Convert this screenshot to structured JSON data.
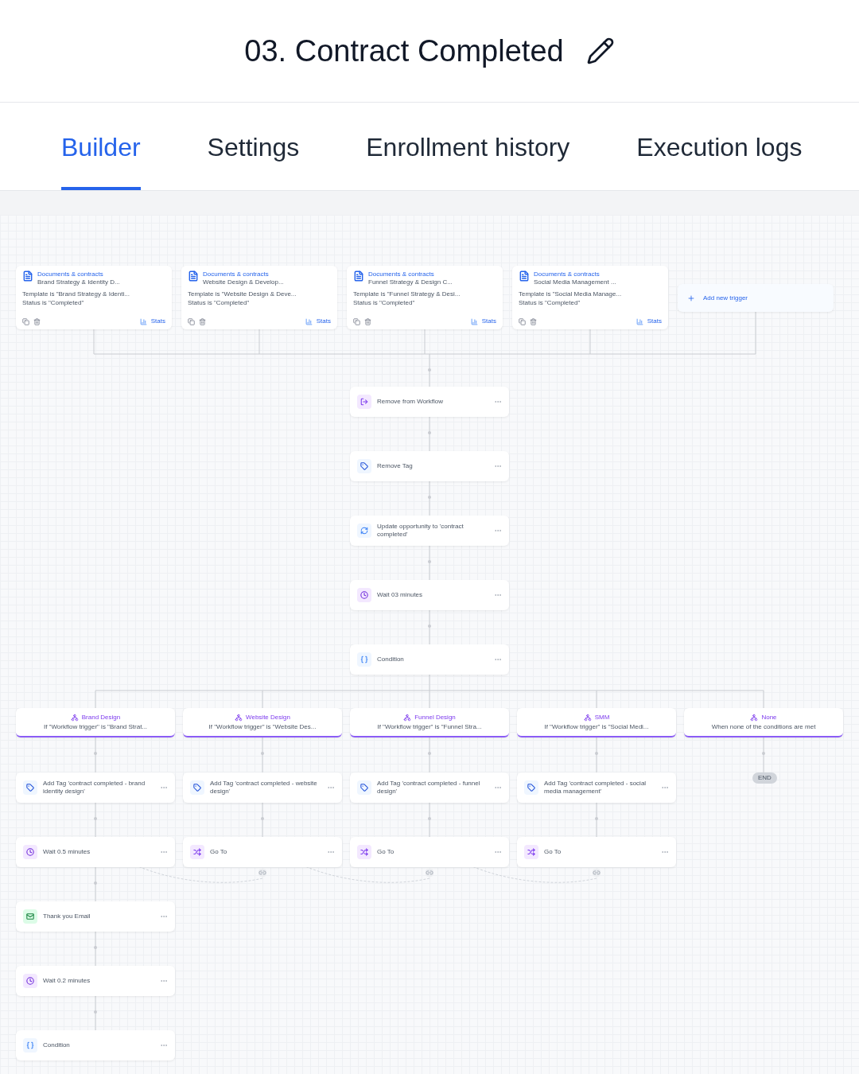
{
  "title": "03. Contract Completed",
  "tabs": [
    {
      "label": "Builder",
      "selected": true
    },
    {
      "label": "Settings",
      "selected": false
    },
    {
      "label": "Enrollment history",
      "selected": false
    },
    {
      "label": "Execution logs",
      "selected": false
    }
  ],
  "triggers": [
    {
      "app": "Documents & contracts",
      "name": "Brand Strategy & Identity D...",
      "conditions": [
        "Template is \"Brand Strategy & Identi...",
        "Status is \"Completed\""
      ],
      "stats": "Stats"
    },
    {
      "app": "Documents & contracts",
      "name": "Website Design & Develop...",
      "conditions": [
        "Template is \"Website Design & Deve...",
        "Status is \"Completed\""
      ],
      "stats": "Stats"
    },
    {
      "app": "Documents & contracts",
      "name": "Funnel Strategy & Design C...",
      "conditions": [
        "Template is \"Funnel Strategy & Desi...",
        "Status is \"Completed\""
      ],
      "stats": "Stats"
    },
    {
      "app": "Documents & contracts",
      "name": "Social Media Management ...",
      "conditions": [
        "Template is \"Social Media Manage...",
        "Status is \"Completed\""
      ],
      "stats": "Stats"
    }
  ],
  "add_trigger": "Add new trigger",
  "actions": [
    {
      "kind": "remove_workflow",
      "label": "Remove from Workflow"
    },
    {
      "kind": "remove_tag",
      "label": "Remove Tag"
    },
    {
      "kind": "update_opportunity",
      "label": "Update opportunity to 'contract completed'"
    },
    {
      "kind": "wait",
      "label": "Wait 03 minutes"
    },
    {
      "kind": "condition",
      "label": "Condition"
    }
  ],
  "branches": [
    {
      "name": "Brand Design",
      "rule": "If \"Workflow trigger\" is \"Brand Strat...",
      "steps": [
        {
          "kind": "add_tag",
          "label": "Add Tag 'contract completed - brand identity design'"
        },
        {
          "kind": "wait",
          "label": "Wait 0.5 minutes"
        },
        {
          "kind": "email",
          "label": "Thank you Email"
        },
        {
          "kind": "wait",
          "label": "Wait 0.2 minutes"
        },
        {
          "kind": "condition",
          "label": "Condition"
        }
      ]
    },
    {
      "name": "Website Design",
      "rule": "If \"Workflow trigger\" is \"Website Des...",
      "steps": [
        {
          "kind": "add_tag",
          "label": "Add Tag 'contract completed - website design'"
        },
        {
          "kind": "goto",
          "label": "Go To"
        }
      ]
    },
    {
      "name": "Funnel Design",
      "rule": "If \"Workflow trigger\" is \"Funnel Stra...",
      "steps": [
        {
          "kind": "add_tag",
          "label": "Add Tag 'contract completed - funnel design'"
        },
        {
          "kind": "goto",
          "label": "Go To"
        }
      ]
    },
    {
      "name": "SMM",
      "rule": "If \"Workflow trigger\" is \"Social Medi...",
      "steps": [
        {
          "kind": "add_tag",
          "label": "Add Tag 'contract completed - social media management'"
        },
        {
          "kind": "goto",
          "label": "Go To"
        }
      ]
    },
    {
      "name": "None",
      "rule": "When none of the conditions are met",
      "steps": [
        {
          "kind": "end",
          "label": "END"
        }
      ]
    }
  ]
}
